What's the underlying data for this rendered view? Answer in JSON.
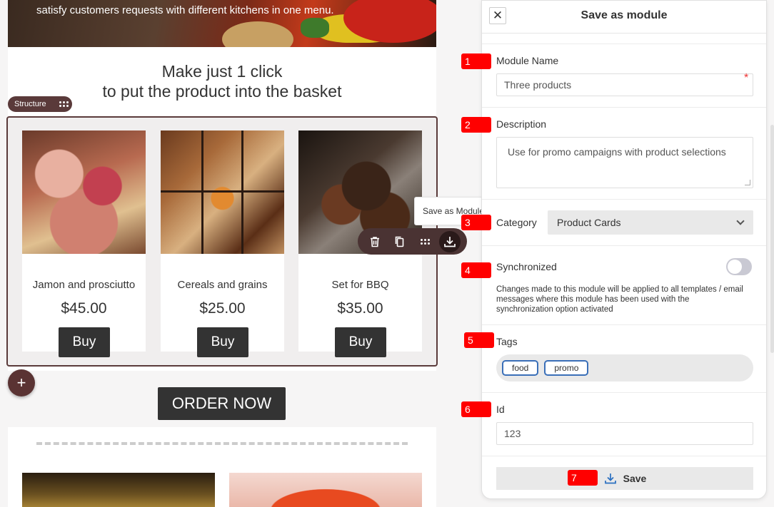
{
  "email": {
    "hero_text": "satisfy customers requests with different kitchens in one menu.",
    "headline_line1": "Make just 1 click",
    "headline_line2": "to put the product into the basket",
    "structure_label": "Structure",
    "products": [
      {
        "name": "Jamon and prosciutto",
        "price": "$45.00",
        "button": "Buy"
      },
      {
        "name": "Cereals and grains",
        "price": "$25.00",
        "button": "Buy"
      },
      {
        "name": "Set for BBQ",
        "price": "$35.00",
        "button": "Buy"
      }
    ],
    "tooltip": "Save as Module",
    "add_label": "+",
    "order_button": "ORDER NOW"
  },
  "panel": {
    "title": "Save as module",
    "close_label": "✕",
    "module_name_label": "Module Name",
    "module_name_value": "Three products",
    "required_mark": "*",
    "description_label": "Description",
    "description_value": "Use for promo campaigns with product selections",
    "category_label": "Category",
    "category_value": "Product Cards",
    "synchronized_label": "Synchronized",
    "synchronized_on": false,
    "synchronized_hint": "Changes made to this module will be applied to all templates / email messages where this module has been used with the synchronization option activated",
    "tags_label": "Tags",
    "tags": [
      "food",
      "promo"
    ],
    "id_label": "Id",
    "id_value": "123",
    "save_label": "Save"
  },
  "markers": [
    "1",
    "2",
    "3",
    "4",
    "5",
    "6",
    "7"
  ],
  "colors": {
    "structure_border": "#5a3a3a",
    "marker": "#ff0000",
    "tag_border": "#3a6fb8",
    "button_dark": "#333333"
  }
}
